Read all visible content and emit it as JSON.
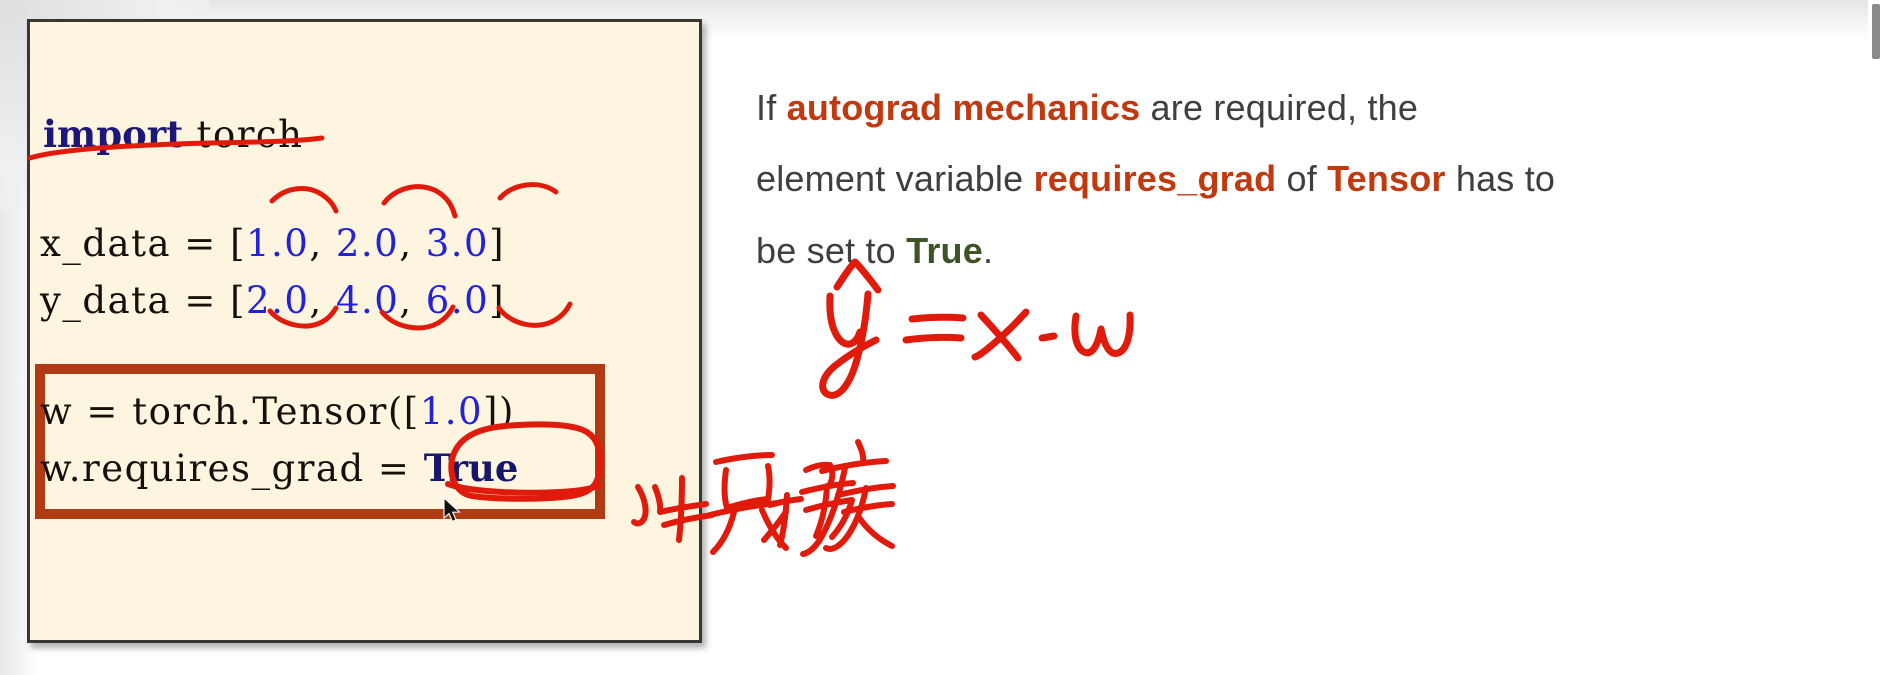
{
  "slide": {
    "code_box": {
      "lines": [
        {
          "id": "import",
          "keyword": "import",
          "rest": " torch"
        },
        {
          "id": "x_data",
          "prefix": "x_data = [",
          "v1": "1.0",
          "sep1": ", ",
          "v2": "2.0",
          "sep2": ", ",
          "v3": "3.0",
          "suffix": "]"
        },
        {
          "id": "y_data",
          "prefix": "y_data = [",
          "v1": "2.0",
          "sep1": ", ",
          "v2": "4.0",
          "sep2": ", ",
          "v3": "6.0",
          "suffix": "]"
        },
        {
          "id": "w_tensor",
          "prefix": "w = torch.Tensor([",
          "v1": "1.0",
          "suffix": "])"
        },
        {
          "id": "requires_grad",
          "prefix": "w.requires_grad = ",
          "value": "True"
        }
      ]
    },
    "prose": {
      "part1": "If ",
      "highlight1": "autograd mechanics",
      "part2": " are required, the element variable ",
      "highlight2": "requires_grad",
      "part3": " of ",
      "highlight3": "Tensor",
      "part4": " has to be set to ",
      "highlight4": "True",
      "part5": "."
    },
    "annotations": {
      "formula": "ŷ = x · w",
      "chinese_note": "计算梯度",
      "underline_import": "red underline under 'import torch'",
      "arcs_over_x_data": "red arcs over 1.0, 2.0, 3.0",
      "arcs_under_y_data": "red arcs under 2.0, 4.0, 6.0",
      "circle_true": "red circle and underline around True"
    },
    "colors": {
      "box_background": "#fdf5e0",
      "box_border": "#3a3631",
      "red_frame": "#b03a14",
      "ink_red": "#e01b0c",
      "keyword_blue": "#1c1878",
      "number_blue": "#2222dd",
      "prose_body": "#3f3f3f",
      "prose_accent": "#c0390f",
      "prose_green": "#3d5524",
      "page_background": "#ffffff"
    }
  }
}
